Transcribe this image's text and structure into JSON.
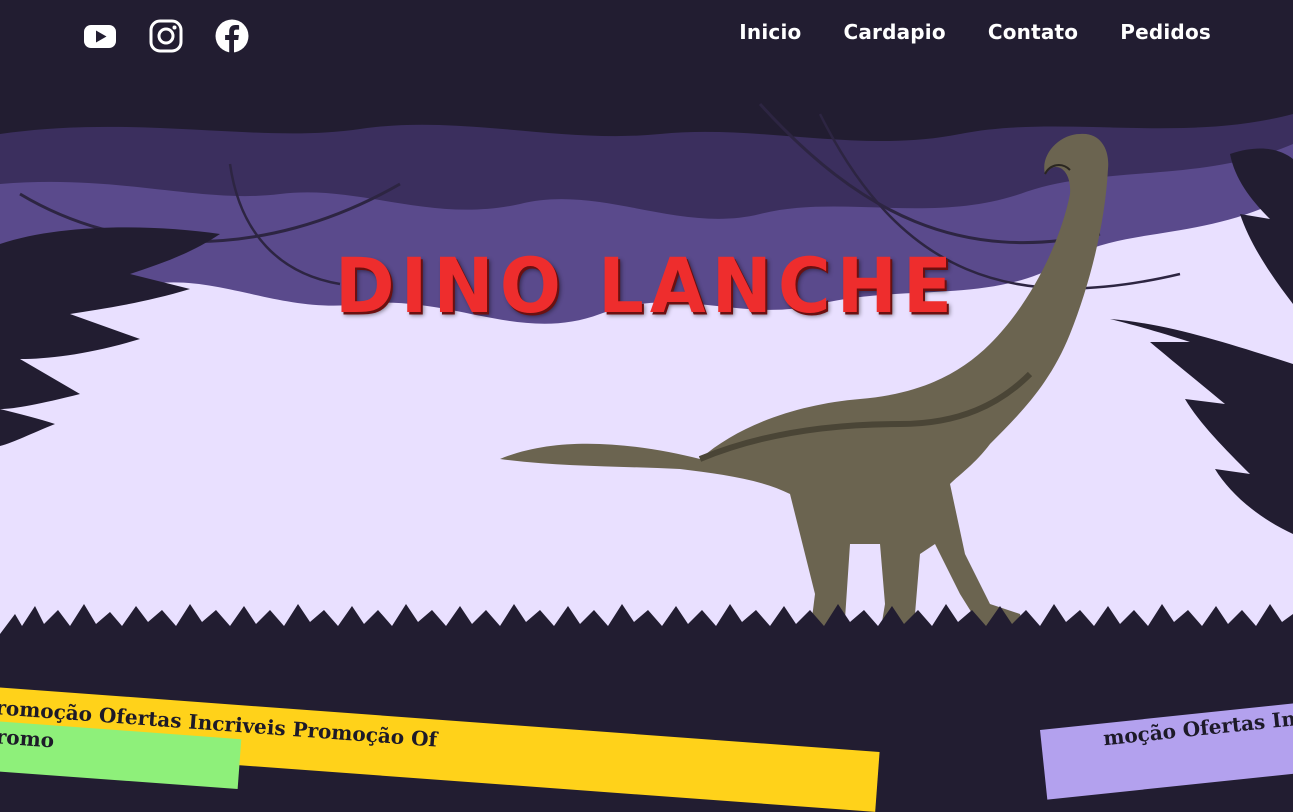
{
  "social": {
    "icons": [
      "youtube-icon",
      "instagram-icon",
      "facebook-icon"
    ]
  },
  "nav": {
    "items": [
      "Inicio",
      "Cardapio",
      "Contato",
      "Pedidos"
    ]
  },
  "hero": {
    "title": "DINO LANCHE"
  },
  "banners": {
    "yellow_text": "Promoção Ofertas Incriveis  Promoção Of",
    "green_text": "Promo",
    "purple_text": "moção Ofertas In"
  },
  "colors": {
    "background": "#221d31",
    "title": "#ee2d2d",
    "sky": "#e9e0ff",
    "foliage_light": "#5a4a8c",
    "banner_yellow": "#ffd21a",
    "banner_green": "#8ef07a",
    "banner_purple": "#b3a1ee"
  }
}
